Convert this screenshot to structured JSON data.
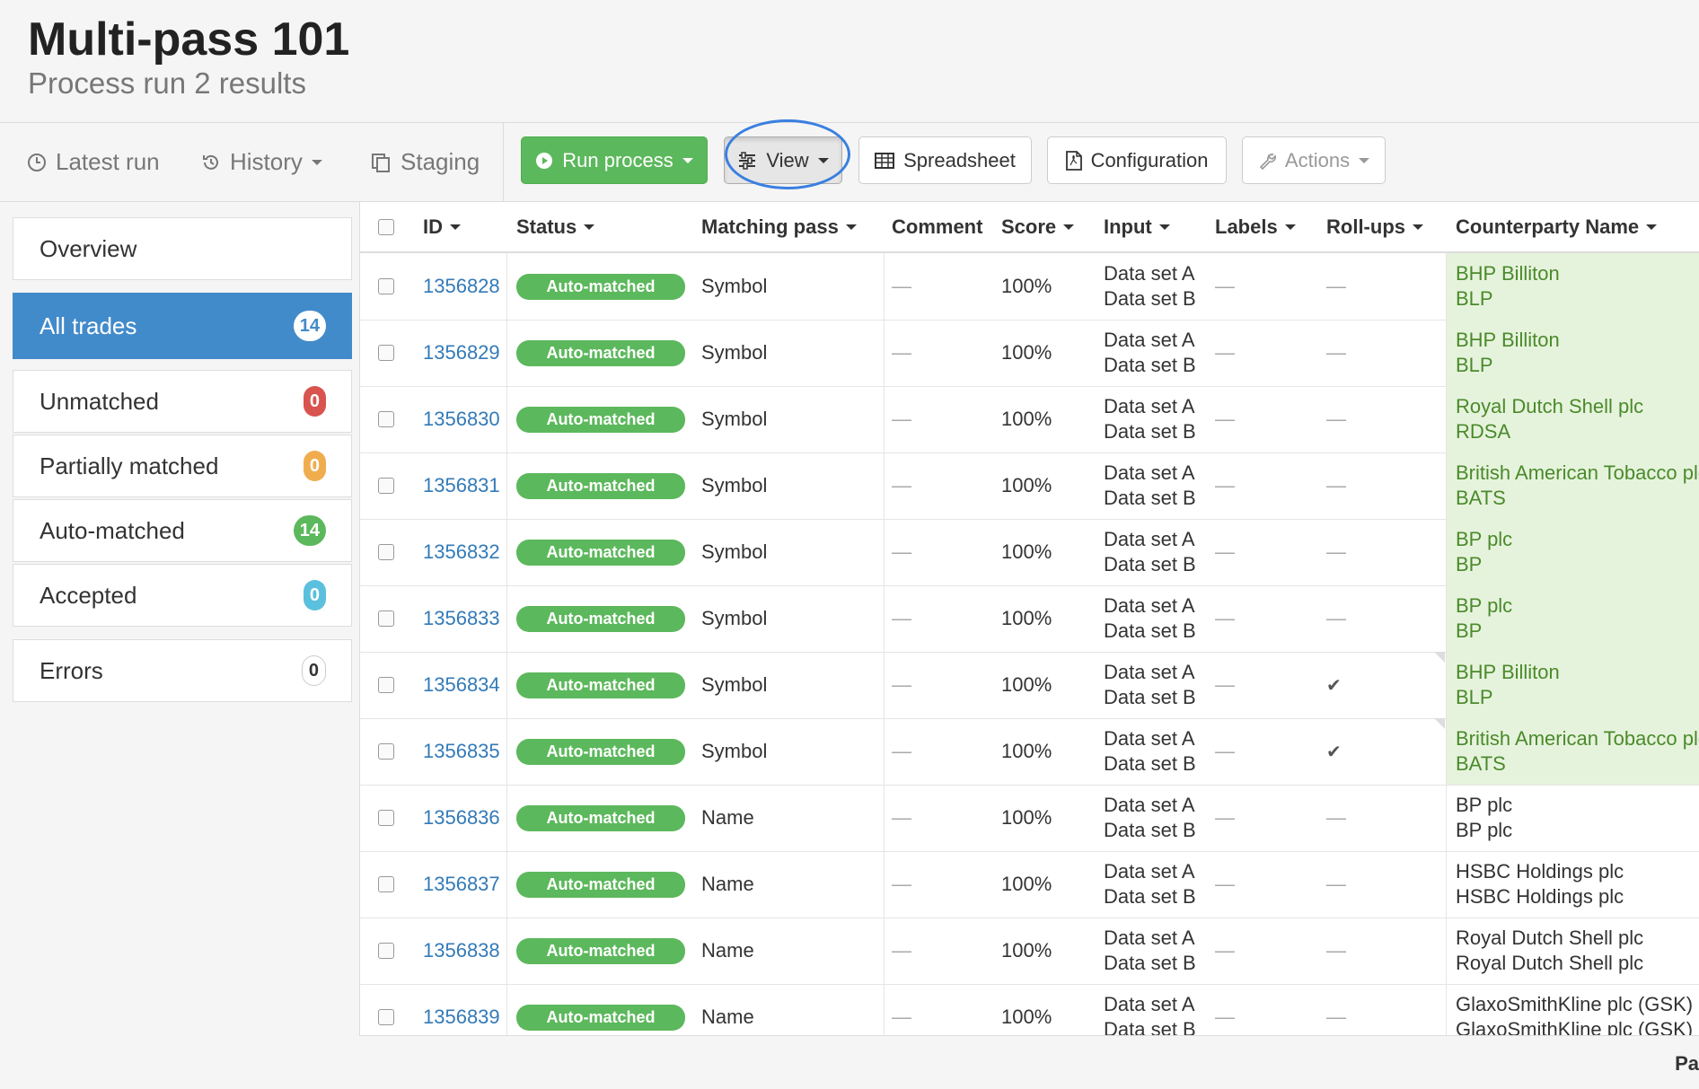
{
  "header": {
    "title": "Multi-pass 101",
    "subtitle": "Process run 2 results"
  },
  "toolbar": {
    "tabs": [
      {
        "label": "Latest run",
        "icon": "clock-icon"
      },
      {
        "label": "History",
        "icon": "history-icon"
      },
      {
        "label": "Staging",
        "icon": "copy-icon"
      }
    ],
    "buttons": {
      "run": "Run process",
      "view": "View",
      "spreadsheet": "Spreadsheet",
      "configuration": "Configuration",
      "actions": "Actions"
    },
    "colors": {
      "run_bg": "#5cb85c",
      "highlight_ring": "#3a7fe0"
    }
  },
  "sidebar": {
    "items": [
      {
        "label": "Overview"
      },
      {
        "label": "All trades",
        "count": "14"
      },
      {
        "label": "Unmatched",
        "count": "0"
      },
      {
        "label": "Partially matched",
        "count": "0"
      },
      {
        "label": "Auto-matched",
        "count": "14"
      },
      {
        "label": "Accepted",
        "count": "0"
      },
      {
        "label": "Errors",
        "count": "0"
      }
    ]
  },
  "table": {
    "columns": {
      "id": "ID",
      "status": "Status",
      "pass": "Matching pass",
      "comment": "Comment",
      "score": "Score",
      "input": "Input",
      "labels": "Labels",
      "rollups": "Roll-ups",
      "counterparty": "Counterparty Name"
    },
    "rows": [
      {
        "id": "1356828",
        "status": "Auto-matched",
        "pass": "Symbol",
        "comment": "—",
        "score": "100%",
        "input_a": "Data set A",
        "input_b": "Data set B",
        "labels": "—",
        "rollups": "—",
        "cp1": "BHP Billiton",
        "cp2": "BLP",
        "cp_highlight": true
      },
      {
        "id": "1356829",
        "status": "Auto-matched",
        "pass": "Symbol",
        "comment": "—",
        "score": "100%",
        "input_a": "Data set A",
        "input_b": "Data set B",
        "labels": "—",
        "rollups": "—",
        "cp1": "BHP Billiton",
        "cp2": "BLP",
        "cp_highlight": true
      },
      {
        "id": "1356830",
        "status": "Auto-matched",
        "pass": "Symbol",
        "comment": "—",
        "score": "100%",
        "input_a": "Data set A",
        "input_b": "Data set B",
        "labels": "—",
        "rollups": "—",
        "cp1": "Royal Dutch Shell plc",
        "cp2": "RDSA",
        "cp_highlight": true
      },
      {
        "id": "1356831",
        "status": "Auto-matched",
        "pass": "Symbol",
        "comment": "—",
        "score": "100%",
        "input_a": "Data set A",
        "input_b": "Data set B",
        "labels": "—",
        "rollups": "—",
        "cp1": "British American Tobacco plc",
        "cp2": "BATS",
        "cp_highlight": true
      },
      {
        "id": "1356832",
        "status": "Auto-matched",
        "pass": "Symbol",
        "comment": "—",
        "score": "100%",
        "input_a": "Data set A",
        "input_b": "Data set B",
        "labels": "—",
        "rollups": "—",
        "cp1": "BP plc",
        "cp2": "BP",
        "cp_highlight": true
      },
      {
        "id": "1356833",
        "status": "Auto-matched",
        "pass": "Symbol",
        "comment": "—",
        "score": "100%",
        "input_a": "Data set A",
        "input_b": "Data set B",
        "labels": "—",
        "rollups": "—",
        "cp1": "BP plc",
        "cp2": "BP",
        "cp_highlight": true
      },
      {
        "id": "1356834",
        "status": "Auto-matched",
        "pass": "Symbol",
        "comment": "—",
        "score": "100%",
        "input_a": "Data set A",
        "input_b": "Data set B",
        "labels": "—",
        "rollups": "✔",
        "cp1": "BHP Billiton",
        "cp2": "BLP",
        "cp_highlight": true
      },
      {
        "id": "1356835",
        "status": "Auto-matched",
        "pass": "Symbol",
        "comment": "—",
        "score": "100%",
        "input_a": "Data set A",
        "input_b": "Data set B",
        "labels": "—",
        "rollups": "✔",
        "cp1": "British American Tobacco plc",
        "cp2": "BATS",
        "cp_highlight": true
      },
      {
        "id": "1356836",
        "status": "Auto-matched",
        "pass": "Name",
        "comment": "—",
        "score": "100%",
        "input_a": "Data set A",
        "input_b": "Data set B",
        "labels": "—",
        "rollups": "—",
        "cp1": "BP plc",
        "cp2": "BP plc",
        "cp_highlight": false
      },
      {
        "id": "1356837",
        "status": "Auto-matched",
        "pass": "Name",
        "comment": "—",
        "score": "100%",
        "input_a": "Data set A",
        "input_b": "Data set B",
        "labels": "—",
        "rollups": "—",
        "cp1": "HSBC Holdings plc",
        "cp2": "HSBC Holdings plc",
        "cp_highlight": false
      },
      {
        "id": "1356838",
        "status": "Auto-matched",
        "pass": "Name",
        "comment": "—",
        "score": "100%",
        "input_a": "Data set A",
        "input_b": "Data set B",
        "labels": "—",
        "rollups": "—",
        "cp1": "Royal Dutch Shell plc",
        "cp2": "Royal Dutch Shell plc",
        "cp_highlight": false
      },
      {
        "id": "1356839",
        "status": "Auto-matched",
        "pass": "Name",
        "comment": "—",
        "score": "100%",
        "input_a": "Data set A",
        "input_b": "Data set B",
        "labels": "—",
        "rollups": "—",
        "cp1": "GlaxoSmithKline plc (GSK)",
        "cp2": "GlaxoSmithKline plc (GSK)",
        "cp_highlight": false
      }
    ]
  },
  "footer": {
    "text": "Pa"
  }
}
